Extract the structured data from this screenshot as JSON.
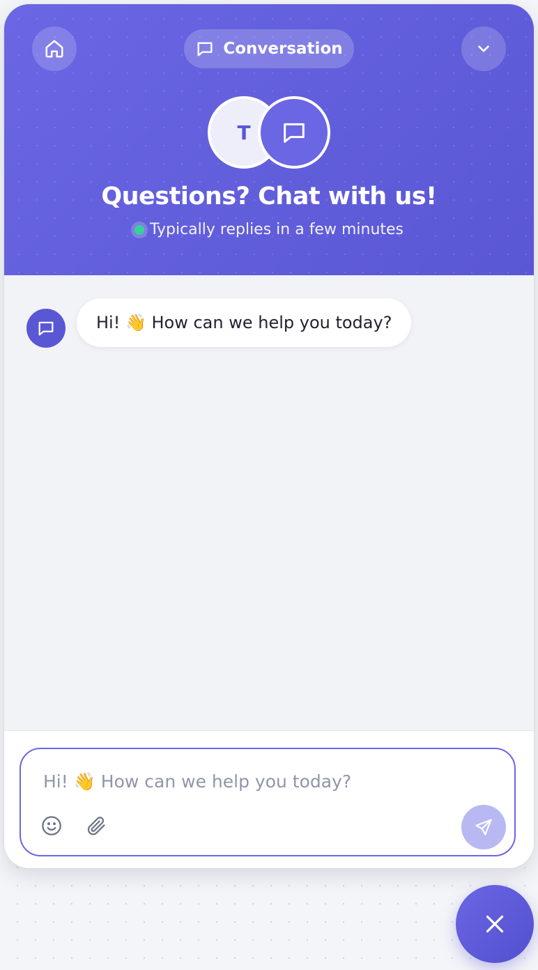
{
  "header": {
    "tab_label": "Conversation",
    "avatar_initial": "T",
    "title": "Questions? Chat with us!",
    "status_text": "Typically replies in a few minutes",
    "status_color": "#34d399"
  },
  "messages": [
    {
      "sender": "bot",
      "text": "Hi! 👋 How can we help you today?"
    }
  ],
  "composer": {
    "placeholder": "Hi! 👋 How can we help you today?",
    "value": ""
  },
  "icons": {
    "home": "home-icon",
    "chat": "chat-bubble-icon",
    "collapse": "chevron-down-icon",
    "emoji": "emoji-smile-icon",
    "attach": "paperclip-icon",
    "send": "send-icon",
    "close": "close-icon"
  },
  "colors": {
    "accent": "#5a57d4",
    "accent_light": "#6a66e4",
    "send_disabled": "#b8b9f2",
    "background": "#f2f3f7"
  }
}
